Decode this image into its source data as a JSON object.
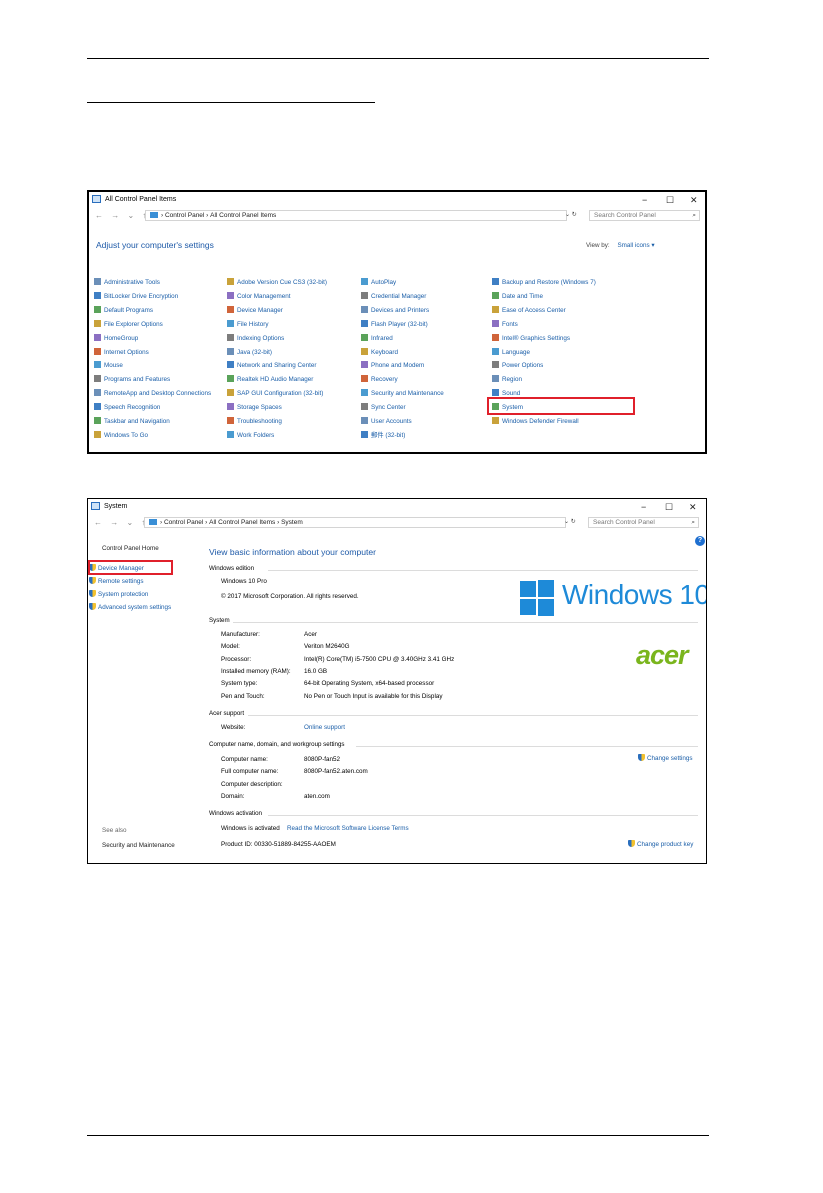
{
  "cp_window": {
    "title": "All Control Panel Items",
    "breadcrumb": [
      "Control Panel",
      "All Control Panel Items"
    ],
    "search_placeholder": "Search Control Panel",
    "heading": "Adjust your computer's settings",
    "view_by_label": "View by:",
    "view_by_value": "Small icons",
    "columns": [
      [
        "Administrative Tools",
        "BitLocker Drive Encryption",
        "Default Programs",
        "File Explorer Options",
        "HomeGroup",
        "Internet Options",
        "Mouse",
        "Programs and Features",
        "RemoteApp and Desktop Connections",
        "Speech Recognition",
        "Taskbar and Navigation",
        "Windows To Go"
      ],
      [
        "Adobe Version Cue CS3 (32-bit)",
        "Color Management",
        "Device Manager",
        "File History",
        "Indexing Options",
        "Java (32-bit)",
        "Network and Sharing Center",
        "Realtek HD Audio Manager",
        "SAP GUI Configuration (32-bit)",
        "Storage Spaces",
        "Troubleshooting",
        "Work Folders"
      ],
      [
        "AutoPlay",
        "Credential Manager",
        "Devices and Printers",
        "Flash Player (32-bit)",
        "Infrared",
        "Keyboard",
        "Phone and Modem",
        "Recovery",
        "Security and Maintenance",
        "Sync Center",
        "User Accounts",
        "郵件 (32-bit)"
      ],
      [
        "Backup and Restore (Windows 7)",
        "Date and Time",
        "Ease of Access Center",
        "Fonts",
        "Intel® Graphics Settings",
        "Language",
        "Power Options",
        "Region",
        "Sound",
        "System",
        "Windows Defender Firewall"
      ]
    ]
  },
  "sys_window": {
    "title": "System",
    "breadcrumb": [
      "Control Panel",
      "All Control Panel Items",
      "System"
    ],
    "search_placeholder": "Search Control Panel",
    "sidebar": {
      "home": "Control Panel Home",
      "links": [
        "Device Manager",
        "Remote settings",
        "System protection",
        "Advanced system settings"
      ],
      "see_also": "See also",
      "security": "Security and Maintenance"
    },
    "heading": "View basic information about your computer",
    "edition": {
      "header": "Windows edition",
      "name": "Windows 10 Pro",
      "copyright": "© 2017 Microsoft Corporation. All rights reserved."
    },
    "logo_text": "Windows 10",
    "acer_logo": "acer",
    "system": {
      "header": "System",
      "rows": [
        {
          "label": "Manufacturer:",
          "value": "Acer"
        },
        {
          "label": "Model:",
          "value": "Veriton M2640G"
        },
        {
          "label": "Processor:",
          "value": "Intel(R) Core(TM) i5-7500 CPU @ 3.40GHz   3.41 GHz"
        },
        {
          "label": "Installed memory (RAM):",
          "value": "16.0 GB"
        },
        {
          "label": "System type:",
          "value": "64-bit Operating System, x64-based processor"
        },
        {
          "label": "Pen and Touch:",
          "value": "No Pen or Touch Input is available for this Display"
        }
      ]
    },
    "support": {
      "header": "Acer support",
      "label": "Website:",
      "value": "Online support"
    },
    "computer": {
      "header": "Computer name, domain, and workgroup settings",
      "rows": [
        {
          "label": "Computer name:",
          "value": "8080P-fan52"
        },
        {
          "label": "Full computer name:",
          "value": "8080P-fan52.aten.com"
        },
        {
          "label": "Computer description:",
          "value": ""
        },
        {
          "label": "Domain:",
          "value": "aten.com"
        }
      ],
      "change": "Change settings"
    },
    "activation": {
      "header": "Windows activation",
      "status": "Windows is activated",
      "license_link": "Read the Microsoft Software License Terms",
      "product_id": "Product ID: 00330-51889-84255-AAOEM",
      "change_key": "Change product key"
    }
  }
}
